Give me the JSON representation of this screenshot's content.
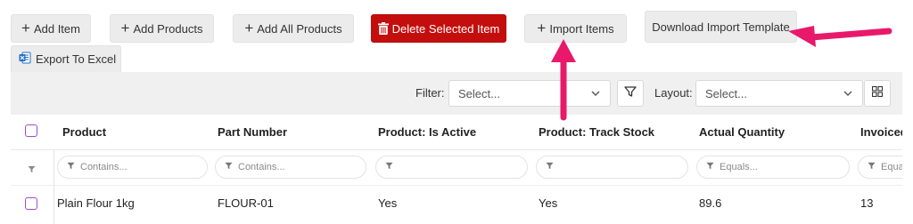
{
  "toolbar": {
    "add_item": "Add Item",
    "add_products": "Add Products",
    "add_all_products": "Add All Products",
    "delete_selected": "Delete Selected Item",
    "import_items": "Import Items",
    "download_template": "Download Import Template",
    "export_excel": "Export To Excel"
  },
  "filterbar": {
    "filter_label": "Filter:",
    "filter_placeholder": "Select...",
    "layout_label": "Layout:",
    "layout_placeholder": "Select..."
  },
  "grid": {
    "columns": [
      "Product",
      "Part Number",
      "Product: Is Active",
      "Product: Track Stock",
      "Actual Quantity",
      "Invoiced"
    ],
    "filters": [
      "Contains...",
      "Contains...",
      "",
      "",
      "Equals...",
      "Equa"
    ],
    "rows": [
      {
        "product": "Plain Flour 1kg",
        "part_number": "FLOUR-01",
        "is_active": "Yes",
        "track_stock": "Yes",
        "actual_qty": "89.6",
        "invoiced": "13"
      }
    ]
  },
  "annotation_color": "#e8196b"
}
